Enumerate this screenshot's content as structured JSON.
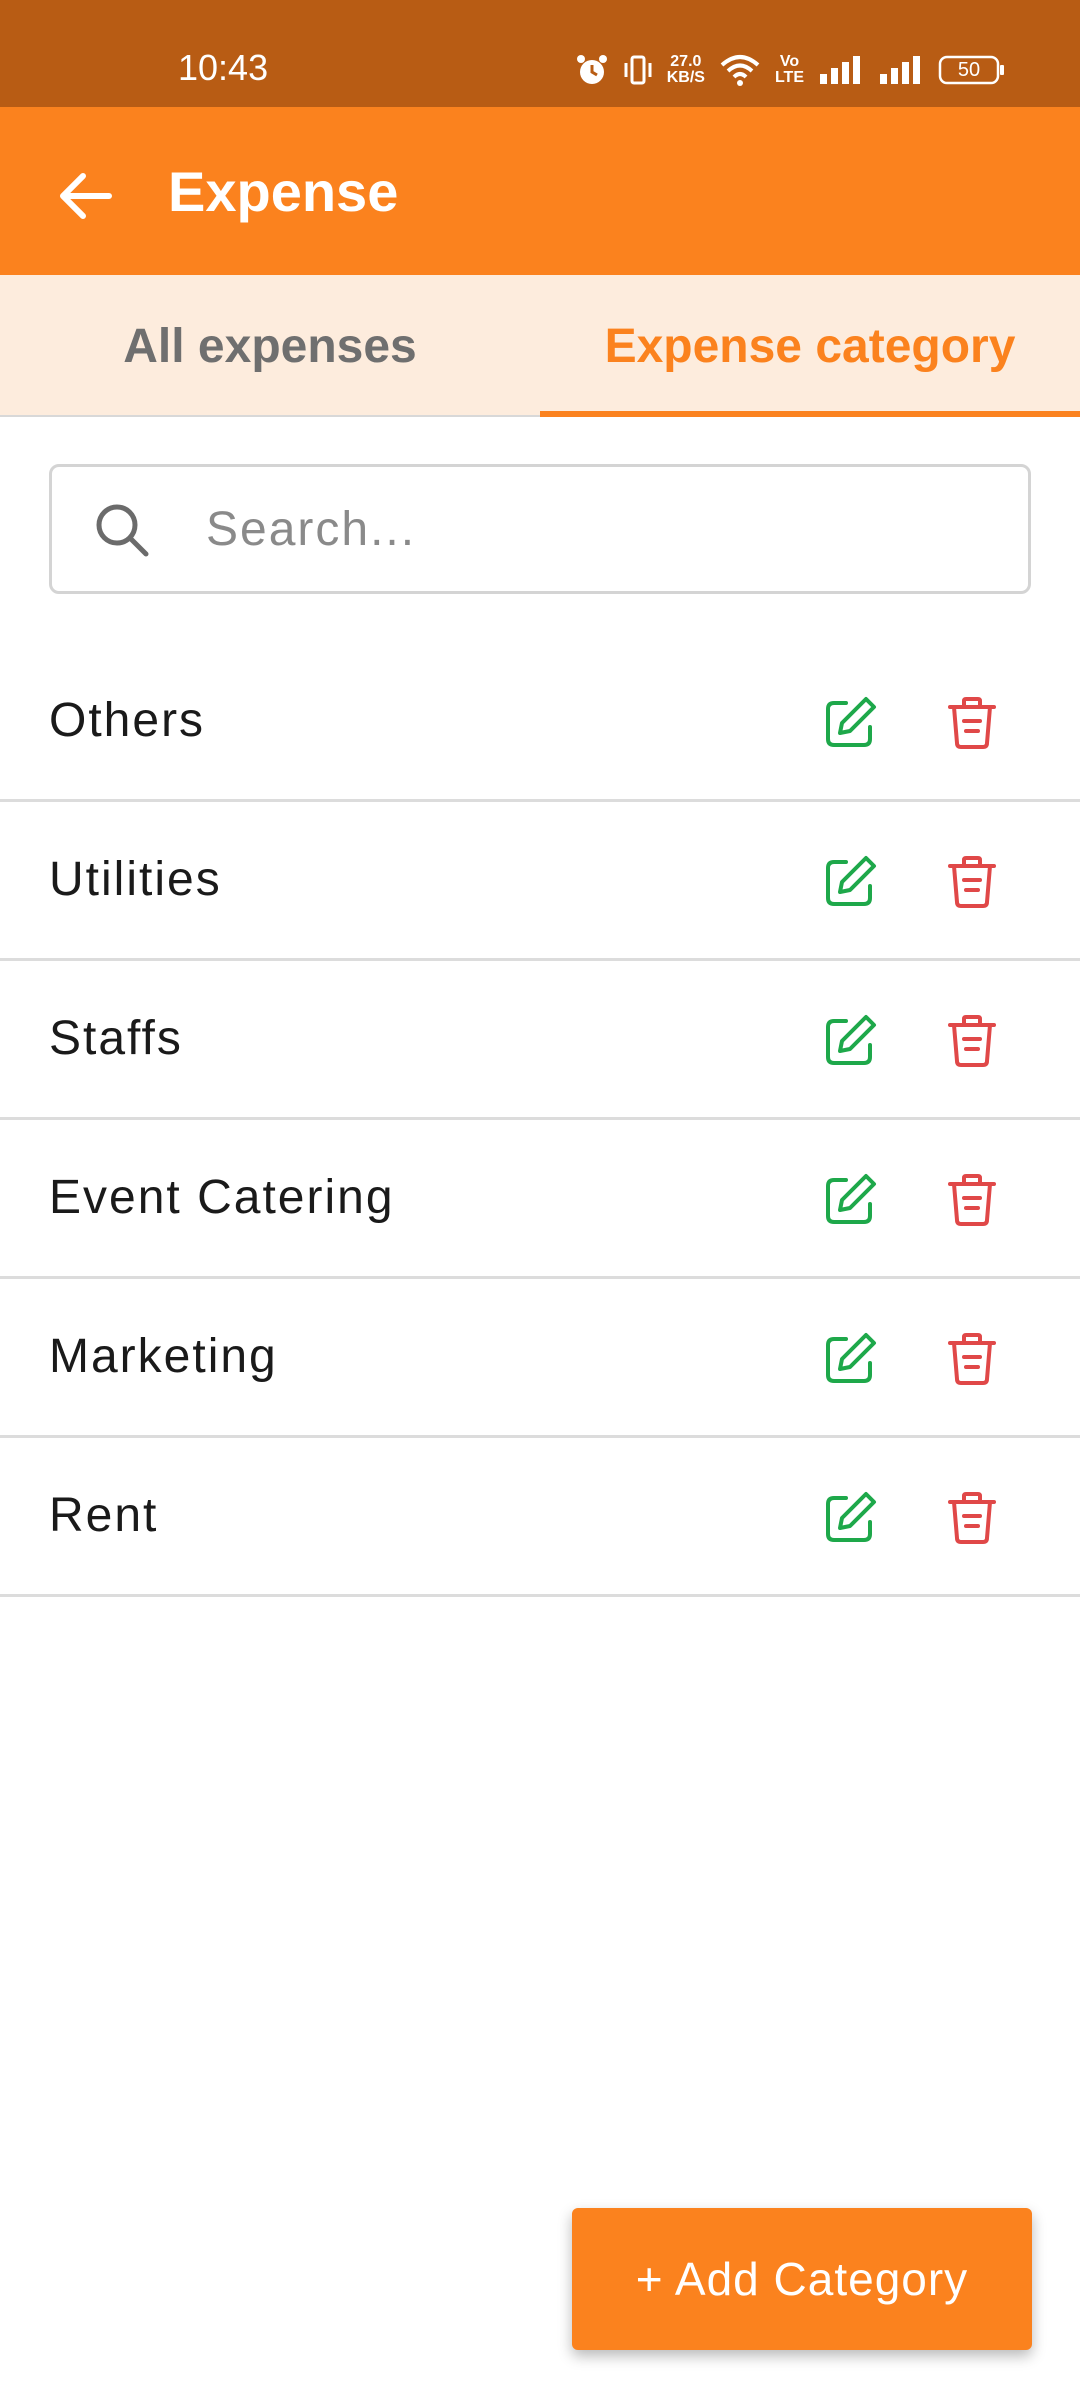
{
  "status_bar": {
    "time": "10:43",
    "net_speed_value": "27.0",
    "net_speed_unit": "KB/S",
    "volte_label_top": "Vo",
    "volte_label_bottom": "LTE",
    "battery_level": "50",
    "icons": [
      "alarm-icon",
      "vibrate-icon",
      "wifi-icon",
      "volte-icon",
      "signal-icon",
      "signal-icon",
      "battery-icon"
    ]
  },
  "app_bar": {
    "title": "Expense",
    "back_icon": "arrow-left-icon"
  },
  "tabs": [
    {
      "label": "All expenses",
      "active": false
    },
    {
      "label": "Expense category",
      "active": true
    }
  ],
  "search": {
    "placeholder": "Search...",
    "value": ""
  },
  "categories": [
    {
      "name": "Others"
    },
    {
      "name": "Utilities"
    },
    {
      "name": "Staffs"
    },
    {
      "name": "Event Catering"
    },
    {
      "name": "Marketing"
    },
    {
      "name": "Rent"
    }
  ],
  "add_button": {
    "label": "+ Add Category"
  },
  "colors": {
    "status_bar": "#b85c14",
    "primary": "#fb821e",
    "tab_background": "#fdecdd",
    "edit": "#1ea84a",
    "delete": "#e04848"
  }
}
